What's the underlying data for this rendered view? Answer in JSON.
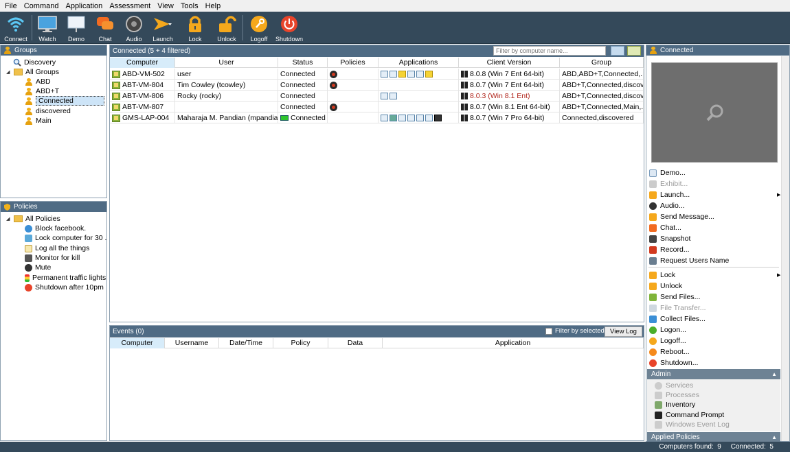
{
  "menu": [
    "File",
    "Command",
    "Application",
    "Assessment",
    "View",
    "Tools",
    "Help"
  ],
  "toolbar": {
    "buttons": [
      {
        "label": "Connect",
        "icon": "wifi-icon"
      },
      {
        "label": "Watch",
        "icon": "monitor-icon"
      },
      {
        "label": "Demo",
        "icon": "presentation-icon"
      },
      {
        "label": "Chat",
        "icon": "chat-icon"
      },
      {
        "label": "Audio",
        "icon": "speaker-icon"
      },
      {
        "label": "Launch",
        "icon": "launch-icon"
      },
      {
        "label": "Lock",
        "icon": "lock-icon"
      },
      {
        "label": "Unlock",
        "icon": "unlock-icon"
      },
      {
        "label": "Logoff",
        "icon": "key-icon"
      },
      {
        "label": "Shutdown",
        "icon": "power-icon"
      }
    ]
  },
  "groups_panel": {
    "title": "Groups",
    "items": [
      "Discovery",
      "All Groups",
      "ABD",
      "ABD+T",
      "Connected",
      "discovered",
      "Main"
    ]
  },
  "policies_panel": {
    "title": "Policies",
    "items": [
      "All Policies",
      "Block facebook.",
      "Lock computer for 30 ...",
      "Log all the things",
      "Monitor for kill",
      "Mute",
      "Permanent traffic lights",
      "Shutdown after 10pm"
    ]
  },
  "computers": {
    "title": "Connected (5 + 4 filtered)",
    "filter_placeholder": "Filter by computer name...",
    "columns": [
      "Computer",
      "User",
      "Status",
      "Policies",
      "Applications",
      "Client Version",
      "Group"
    ],
    "rows": [
      {
        "computer": "ABD-VM-502",
        "user": "user",
        "status": "Connected",
        "version": "8.0.8 (Win 7 Ent 64-bit)",
        "group": "ABD,ABD+T,Connected,..."
      },
      {
        "computer": "ABT-VM-804",
        "user": "Tim Cowley (tcowley)",
        "status": "Connected",
        "version": "8.0.7 (Win 7 Ent 64-bit)",
        "group": "ABD+T,Connected,discov..."
      },
      {
        "computer": "ABT-VM-806",
        "user": "Rocky (rocky)",
        "status": "Connected",
        "version": "8.0.3 (Win 8.1 Ent)",
        "group": "ABD+T,Connected,discov..."
      },
      {
        "computer": "ABT-VM-807",
        "user": "",
        "status": "Connected",
        "version": "8.0.7 (Win 8.1 Ent 64-bit)",
        "group": "ABD+T,Connected,Main,..."
      },
      {
        "computer": "GMS-LAP-004",
        "user": "Maharaja M. Pandian (mpandian)",
        "status": "Connected",
        "version": "8.0.7 (Win 7 Pro 64-bit)",
        "group": "Connected,discovered"
      }
    ]
  },
  "events": {
    "title": "Events (0)",
    "filter_label": "Filter by selected",
    "view_log": "View Log",
    "columns": [
      "Computer",
      "Username",
      "Date/Time",
      "Policy",
      "Data",
      "Application"
    ]
  },
  "right_panel": {
    "title": "Connected",
    "actions": [
      {
        "label": "Demo...",
        "enabled": true
      },
      {
        "label": "Exhibit...",
        "enabled": false
      },
      {
        "label": "Launch...",
        "enabled": true
      },
      {
        "label": "Audio...",
        "enabled": true
      },
      {
        "label": "Send Message...",
        "enabled": true
      },
      {
        "label": "Chat...",
        "enabled": true
      },
      {
        "label": "Snapshot",
        "enabled": true
      },
      {
        "label": "Record...",
        "enabled": true
      },
      {
        "label": "Request Users Name",
        "enabled": true
      },
      {
        "label": "Lock",
        "enabled": true
      },
      {
        "label": "Unlock",
        "enabled": true
      },
      {
        "label": "Send Files...",
        "enabled": true
      },
      {
        "label": "File Transfer...",
        "enabled": false
      },
      {
        "label": "Collect Files...",
        "enabled": true
      },
      {
        "label": "Logon...",
        "enabled": true
      },
      {
        "label": "Logoff...",
        "enabled": true
      },
      {
        "label": "Reboot...",
        "enabled": true
      },
      {
        "label": "Shutdown...",
        "enabled": true
      }
    ],
    "admin_title": "Admin",
    "admin_items": [
      {
        "label": "Services",
        "enabled": false
      },
      {
        "label": "Processes",
        "enabled": false
      },
      {
        "label": "Inventory",
        "enabled": true
      },
      {
        "label": "Command Prompt",
        "enabled": true
      },
      {
        "label": "Windows Event Log",
        "enabled": false
      }
    ],
    "applied_policies": "Applied Policies"
  },
  "status": {
    "text": "Computers found:  9     Connected:  5"
  }
}
